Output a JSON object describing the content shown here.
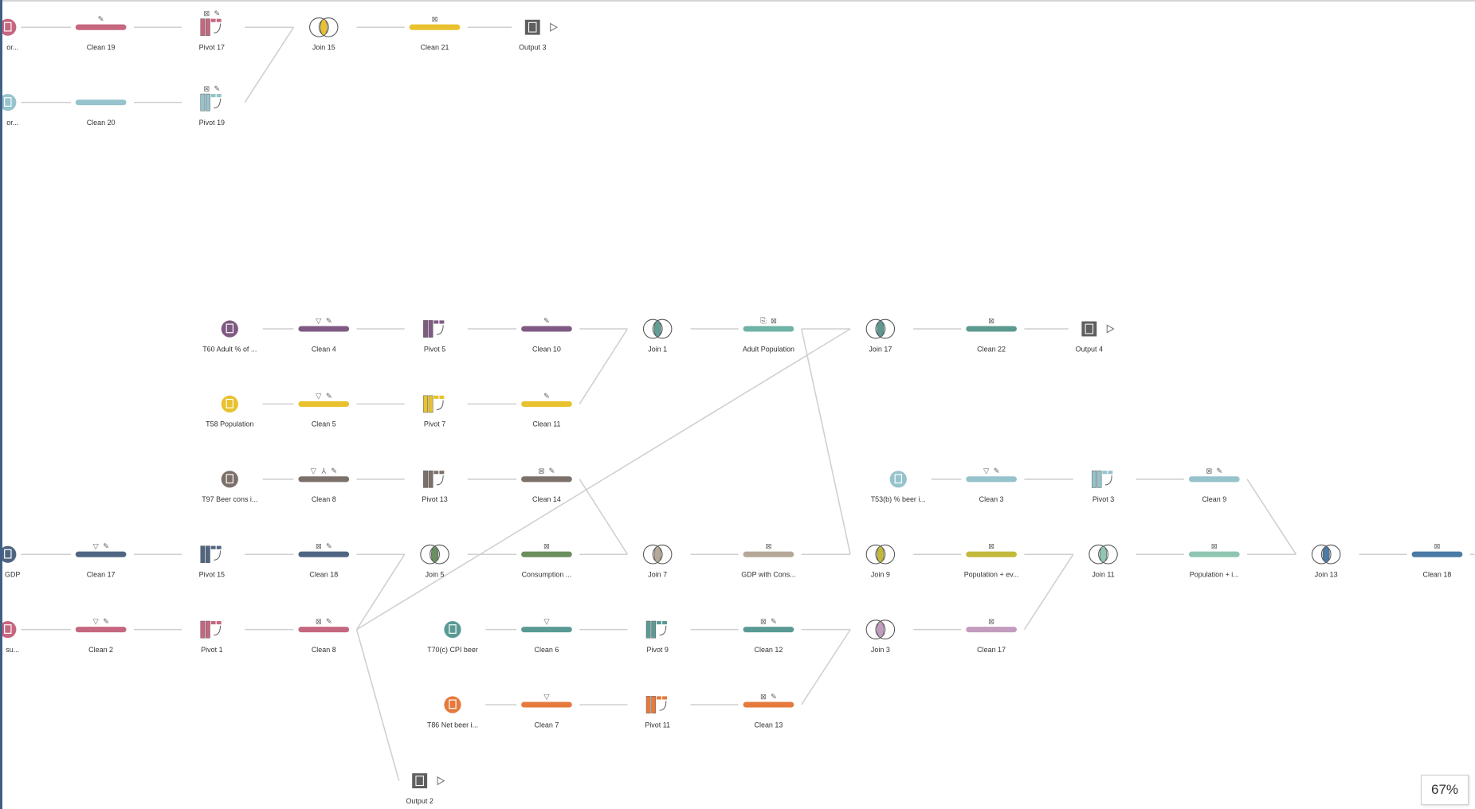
{
  "zoom_level": "67%",
  "nodes": [
    {
      "id": "in19",
      "type": "input",
      "label": "or...",
      "color": "#c5677f",
      "icons": []
    },
    {
      "id": "c19",
      "type": "clean",
      "label": "Clean 19",
      "color": "#c5677f",
      "icons": [
        "edit"
      ]
    },
    {
      "id": "p17",
      "type": "pivot",
      "label": "Pivot 17",
      "color": "#c5677f",
      "icons": [
        "calc",
        "edit"
      ]
    },
    {
      "id": "j15",
      "type": "join",
      "label": "Join 15",
      "color": "#e8c22e",
      "icons": []
    },
    {
      "id": "c21",
      "type": "clean",
      "label": "Clean 21",
      "color": "#e8c22e",
      "icons": [
        "calc"
      ]
    },
    {
      "id": "o3",
      "type": "output",
      "label": "Output 3",
      "color": "#5f5f5f",
      "icons": []
    },
    {
      "id": "in20",
      "type": "input",
      "label": "or...",
      "color": "#96c3cc",
      "icons": []
    },
    {
      "id": "c20",
      "type": "clean",
      "label": "Clean 20",
      "color": "#96c3cc",
      "icons": []
    },
    {
      "id": "p19",
      "type": "pivot",
      "label": "Pivot 19",
      "color": "#96c3cc",
      "icons": [
        "calc",
        "edit"
      ]
    },
    {
      "id": "t60",
      "type": "input",
      "label": "T60 Adult % of ...",
      "color": "#7f5a83",
      "icons": []
    },
    {
      "id": "c4",
      "type": "clean",
      "label": "Clean 4",
      "color": "#7f5a83",
      "icons": [
        "filter",
        "edit"
      ]
    },
    {
      "id": "p5",
      "type": "pivot",
      "label": "Pivot 5",
      "color": "#7f5a83",
      "icons": []
    },
    {
      "id": "c10",
      "type": "clean",
      "label": "Clean 10",
      "color": "#7f5a83",
      "icons": [
        "edit"
      ]
    },
    {
      "id": "j1",
      "type": "join",
      "label": "Join 1",
      "color": "#5f9e95",
      "icons": []
    },
    {
      "id": "ap",
      "type": "clean",
      "label": "Adult Population",
      "color": "#6fb3a7",
      "icons": [
        "copy",
        "calc"
      ]
    },
    {
      "id": "j17",
      "type": "join",
      "label": "Join 17",
      "color": "#5b9b8f",
      "icons": []
    },
    {
      "id": "c22",
      "type": "clean",
      "label": "Clean 22",
      "color": "#5b9b8f",
      "icons": [
        "calc"
      ]
    },
    {
      "id": "o4",
      "type": "output",
      "label": "Output 4",
      "color": "#5f5f5f",
      "icons": []
    },
    {
      "id": "t58",
      "type": "input",
      "label": "T58 Population",
      "color": "#e8c22e",
      "icons": []
    },
    {
      "id": "c5",
      "type": "clean",
      "label": "Clean 5",
      "color": "#e8c22e",
      "icons": [
        "filter",
        "edit"
      ]
    },
    {
      "id": "p7",
      "type": "pivot",
      "label": "Pivot 7",
      "color": "#e8c22e",
      "icons": []
    },
    {
      "id": "c11",
      "type": "clean",
      "label": "Clean 11",
      "color": "#e8c22e",
      "icons": [
        "edit"
      ]
    },
    {
      "id": "t97",
      "type": "input",
      "label": "T97 Beer cons i...",
      "color": "#7c706a",
      "icons": []
    },
    {
      "id": "c8g",
      "type": "clean",
      "label": "Clean 8",
      "color": "#7c706a",
      "icons": [
        "filter",
        "split",
        "edit"
      ]
    },
    {
      "id": "p13",
      "type": "pivot",
      "label": "Pivot 13",
      "color": "#7c706a",
      "icons": []
    },
    {
      "id": "c14",
      "type": "clean",
      "label": "Clean 14",
      "color": "#7c706a",
      "icons": [
        "calc",
        "edit"
      ]
    },
    {
      "id": "t53",
      "type": "input",
      "label": "T53(b) % beer i...",
      "color": "#96c3cc",
      "icons": []
    },
    {
      "id": "c3",
      "type": "clean",
      "label": "Clean 3",
      "color": "#96c3cc",
      "icons": [
        "filter",
        "edit"
      ]
    },
    {
      "id": "p3",
      "type": "pivot",
      "label": "Pivot 3",
      "color": "#96c3cc",
      "icons": []
    },
    {
      "id": "c9",
      "type": "clean",
      "label": "Clean 9",
      "color": "#96c3cc",
      "icons": [
        "calc",
        "edit"
      ]
    },
    {
      "id": "gdp",
      "type": "input",
      "label": "GDP",
      "color": "#4f6682",
      "icons": []
    },
    {
      "id": "c17",
      "type": "clean",
      "label": "Clean 17",
      "color": "#4f6682",
      "icons": [
        "filter",
        "edit"
      ]
    },
    {
      "id": "p15",
      "type": "pivot",
      "label": "Pivot 15",
      "color": "#4f6682",
      "icons": []
    },
    {
      "id": "c18",
      "type": "clean",
      "label": "Clean 18",
      "color": "#4f6682",
      "icons": [
        "calc",
        "edit"
      ]
    },
    {
      "id": "j5",
      "type": "join",
      "label": "Join 5",
      "color": "#6b8f5e",
      "icons": []
    },
    {
      "id": "cons",
      "type": "clean",
      "label": "Consumption ...",
      "color": "#6b8f5e",
      "icons": [
        "calc"
      ]
    },
    {
      "id": "j7",
      "type": "join",
      "label": "Join 7",
      "color": "#b5a898",
      "icons": []
    },
    {
      "id": "gwc",
      "type": "clean",
      "label": "GDP with Cons...",
      "color": "#b5a898",
      "icons": [
        "calc"
      ]
    },
    {
      "id": "j9",
      "type": "join",
      "label": "Join 9",
      "color": "#c2b93a",
      "icons": []
    },
    {
      "id": "popev",
      "type": "clean",
      "label": "Population + ev...",
      "color": "#c2b93a",
      "icons": [
        "calc"
      ]
    },
    {
      "id": "j11",
      "type": "join",
      "label": "Join 11",
      "color": "#8fc6b2",
      "icons": []
    },
    {
      "id": "popi",
      "type": "clean",
      "label": "Population + i...",
      "color": "#8fc6b2",
      "icons": [
        "calc"
      ]
    },
    {
      "id": "j13",
      "type": "join",
      "label": "Join 13",
      "color": "#4a7aa5",
      "icons": []
    },
    {
      "id": "c18b",
      "type": "clean",
      "label": "Clean 18",
      "color": "#4a7aa5",
      "icons": [
        "calc"
      ]
    },
    {
      "id": "su",
      "type": "input",
      "label": "su...",
      "color": "#c5677f",
      "icons": []
    },
    {
      "id": "c2",
      "type": "clean",
      "label": "Clean 2",
      "color": "#c5677f",
      "icons": [
        "filter",
        "edit"
      ]
    },
    {
      "id": "p1",
      "type": "pivot",
      "label": "Pivot 1",
      "color": "#c5677f",
      "icons": []
    },
    {
      "id": "c8p",
      "type": "clean",
      "label": "Clean 8",
      "color": "#c5677f",
      "icons": [
        "calc",
        "edit"
      ]
    },
    {
      "id": "t70",
      "type": "input",
      "label": "T70(c) CPI beer",
      "color": "#5a9a95",
      "icons": []
    },
    {
      "id": "c6",
      "type": "clean",
      "label": "Clean 6",
      "color": "#5a9a95",
      "icons": [
        "filter"
      ]
    },
    {
      "id": "p9",
      "type": "pivot",
      "label": "Pivot 9",
      "color": "#5a9a95",
      "icons": []
    },
    {
      "id": "c12",
      "type": "clean",
      "label": "Clean 12",
      "color": "#5a9a95",
      "icons": [
        "calc",
        "edit"
      ]
    },
    {
      "id": "j3",
      "type": "join",
      "label": "Join 3",
      "color": "#c39bbf",
      "icons": []
    },
    {
      "id": "c17b",
      "type": "clean",
      "label": "Clean 17",
      "color": "#c39bbf",
      "icons": [
        "calc"
      ]
    },
    {
      "id": "t86",
      "type": "input",
      "label": "T86 Net beer i...",
      "color": "#e57a3c",
      "icons": []
    },
    {
      "id": "c7",
      "type": "clean",
      "label": "Clean 7",
      "color": "#e57a3c",
      "icons": [
        "filter"
      ]
    },
    {
      "id": "p11",
      "type": "pivot",
      "label": "Pivot 11",
      "color": "#e57a3c",
      "icons": []
    },
    {
      "id": "c13",
      "type": "clean",
      "label": "Clean 13",
      "color": "#e57a3c",
      "icons": [
        "calc",
        "edit"
      ]
    },
    {
      "id": "o2",
      "type": "output",
      "label": "Output 2",
      "color": "#5f5f5f",
      "icons": []
    }
  ],
  "edges": [
    [
      "in19",
      "c19"
    ],
    [
      "c19",
      "p17"
    ],
    [
      "p17",
      "j15"
    ],
    [
      "j15",
      "c21"
    ],
    [
      "c21",
      "o3"
    ],
    [
      "in20",
      "c20"
    ],
    [
      "c20",
      "p19"
    ],
    [
      "p19",
      "j15"
    ],
    [
      "t60",
      "c4"
    ],
    [
      "c4",
      "p5"
    ],
    [
      "p5",
      "c10"
    ],
    [
      "c10",
      "j1"
    ],
    [
      "j1",
      "ap"
    ],
    [
      "ap",
      "j17"
    ],
    [
      "j17",
      "c22"
    ],
    [
      "c22",
      "o4"
    ],
    [
      "t58",
      "c5"
    ],
    [
      "c5",
      "p7"
    ],
    [
      "p7",
      "c11"
    ],
    [
      "c11",
      "j1"
    ],
    [
      "t97",
      "c8g"
    ],
    [
      "c8g",
      "p13"
    ],
    [
      "p13",
      "c14"
    ],
    [
      "c14",
      "j7"
    ],
    [
      "t53",
      "c3"
    ],
    [
      "c3",
      "p3"
    ],
    [
      "p3",
      "c9"
    ],
    [
      "c9",
      "j13"
    ],
    [
      "gdp",
      "c17"
    ],
    [
      "c17",
      "p15"
    ],
    [
      "p15",
      "c18"
    ],
    [
      "c18",
      "j5"
    ],
    [
      "j5",
      "cons"
    ],
    [
      "cons",
      "j7"
    ],
    [
      "j7",
      "gwc"
    ],
    [
      "gwc",
      "j9"
    ],
    [
      "ap",
      "j9"
    ],
    [
      "j9",
      "popev"
    ],
    [
      "popev",
      "j11"
    ],
    [
      "j11",
      "popi"
    ],
    [
      "popi",
      "j13"
    ],
    [
      "j13",
      "c18b"
    ],
    [
      "su",
      "c2"
    ],
    [
      "c2",
      "p1"
    ],
    [
      "p1",
      "c8p"
    ],
    [
      "c8p",
      "j5"
    ],
    [
      "c8p",
      "j17"
    ],
    [
      "c8p",
      "o2"
    ],
    [
      "t70",
      "c6"
    ],
    [
      "c6",
      "p9"
    ],
    [
      "p9",
      "c12"
    ],
    [
      "c12",
      "j3"
    ],
    [
      "j3",
      "c17b"
    ],
    [
      "c17b",
      "j11"
    ],
    [
      "t86",
      "c7"
    ],
    [
      "c7",
      "p11"
    ],
    [
      "p11",
      "c13"
    ],
    [
      "c13",
      "j3"
    ]
  ]
}
